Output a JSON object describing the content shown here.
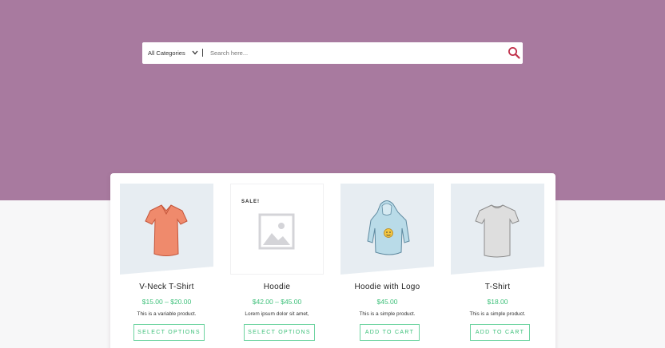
{
  "colors": {
    "hero_bg": "#a87a9f",
    "accent_green": "#3ec07a",
    "search_icon": "#c0304a"
  },
  "search": {
    "category_label": "All Categories",
    "placeholder": "Search here...",
    "value": "",
    "chevron_icon": "chevron-down-icon",
    "submit_icon": "search-icon"
  },
  "products": [
    {
      "title": "V-Neck T-Shirt",
      "price": "$15.00 – $20.00",
      "description": "This is a variable product.",
      "button": "SELECT OPTIONS",
      "image": "vneck-tshirt",
      "sale": ""
    },
    {
      "title": "Hoodie",
      "price": "$42.00 – $45.00",
      "description": "Lorem ipsum dolor sit amet,",
      "button": "SELECT OPTIONS",
      "image": "placeholder",
      "sale": "SALE!"
    },
    {
      "title": "Hoodie with Logo",
      "price": "$45.00",
      "description": "This is a simple product.",
      "button": "ADD TO CART",
      "image": "hoodie-logo",
      "sale": ""
    },
    {
      "title": "T-Shirt",
      "price": "$18.00",
      "description": "This is a simple product.",
      "button": "ADD TO CART",
      "image": "tshirt",
      "sale": ""
    }
  ]
}
